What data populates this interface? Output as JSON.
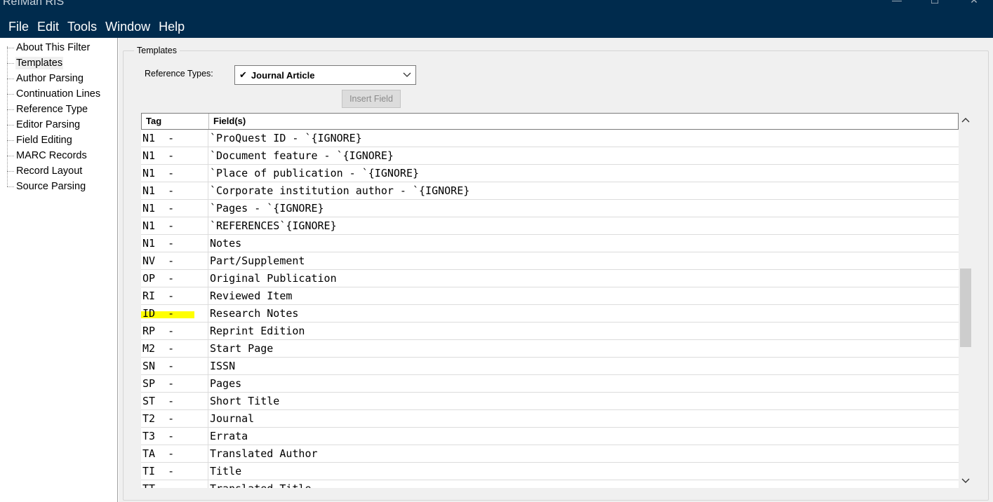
{
  "window": {
    "title": "RefMan RIS",
    "menu": [
      "File",
      "Edit",
      "Tools",
      "Window",
      "Help"
    ]
  },
  "tree": {
    "items": [
      {
        "label": "About This Filter"
      },
      {
        "label": "Templates",
        "selected": true
      },
      {
        "label": "Author Parsing"
      },
      {
        "label": "Continuation Lines"
      },
      {
        "label": "Reference Type"
      },
      {
        "label": "Editor Parsing"
      },
      {
        "label": "Field Editing"
      },
      {
        "label": "MARC Records"
      },
      {
        "label": "Record Layout"
      },
      {
        "label": "Source Parsing"
      }
    ]
  },
  "templates": {
    "group_title": "Templates",
    "reference_types_label": "Reference Types:",
    "reference_type_value": "Journal Article",
    "insert_field_label": "Insert Field",
    "columns": {
      "tag": "Tag",
      "fields": "Field(s)"
    },
    "rows": [
      {
        "tag": "N1",
        "field": "`ProQuest ID - `{IGNORE}"
      },
      {
        "tag": "N1",
        "field": "`Document feature - `{IGNORE}"
      },
      {
        "tag": "N1",
        "field": "`Place of publication - `{IGNORE}"
      },
      {
        "tag": "N1",
        "field": "`Corporate institution author - `{IGNORE}"
      },
      {
        "tag": "N1",
        "field": "`Pages - `{IGNORE}"
      },
      {
        "tag": "N1",
        "field": "`REFERENCES`{IGNORE}"
      },
      {
        "tag": "N1",
        "field": "Notes"
      },
      {
        "tag": "NV",
        "field": "Part/Supplement"
      },
      {
        "tag": "OP",
        "field": "Original Publication"
      },
      {
        "tag": "RI",
        "field": "Reviewed Item"
      },
      {
        "tag": "ID",
        "field": "Research Notes",
        "highlighted": true
      },
      {
        "tag": "RP",
        "field": "Reprint Edition"
      },
      {
        "tag": "M2",
        "field": "Start Page"
      },
      {
        "tag": "SN",
        "field": "ISSN"
      },
      {
        "tag": "SP",
        "field": "Pages"
      },
      {
        "tag": "ST",
        "field": "Short Title"
      },
      {
        "tag": "T2",
        "field": "Journal"
      },
      {
        "tag": "T3",
        "field": "Errata"
      },
      {
        "tag": "TA",
        "field": "Translated Author"
      },
      {
        "tag": "TI",
        "field": "Title"
      },
      {
        "tag": "TT",
        "field": "Translated Title"
      }
    ],
    "highlight_color": "#ffff00"
  },
  "colors": {
    "titlebar": "#002b4d",
    "panel": "#f0f0f0"
  }
}
